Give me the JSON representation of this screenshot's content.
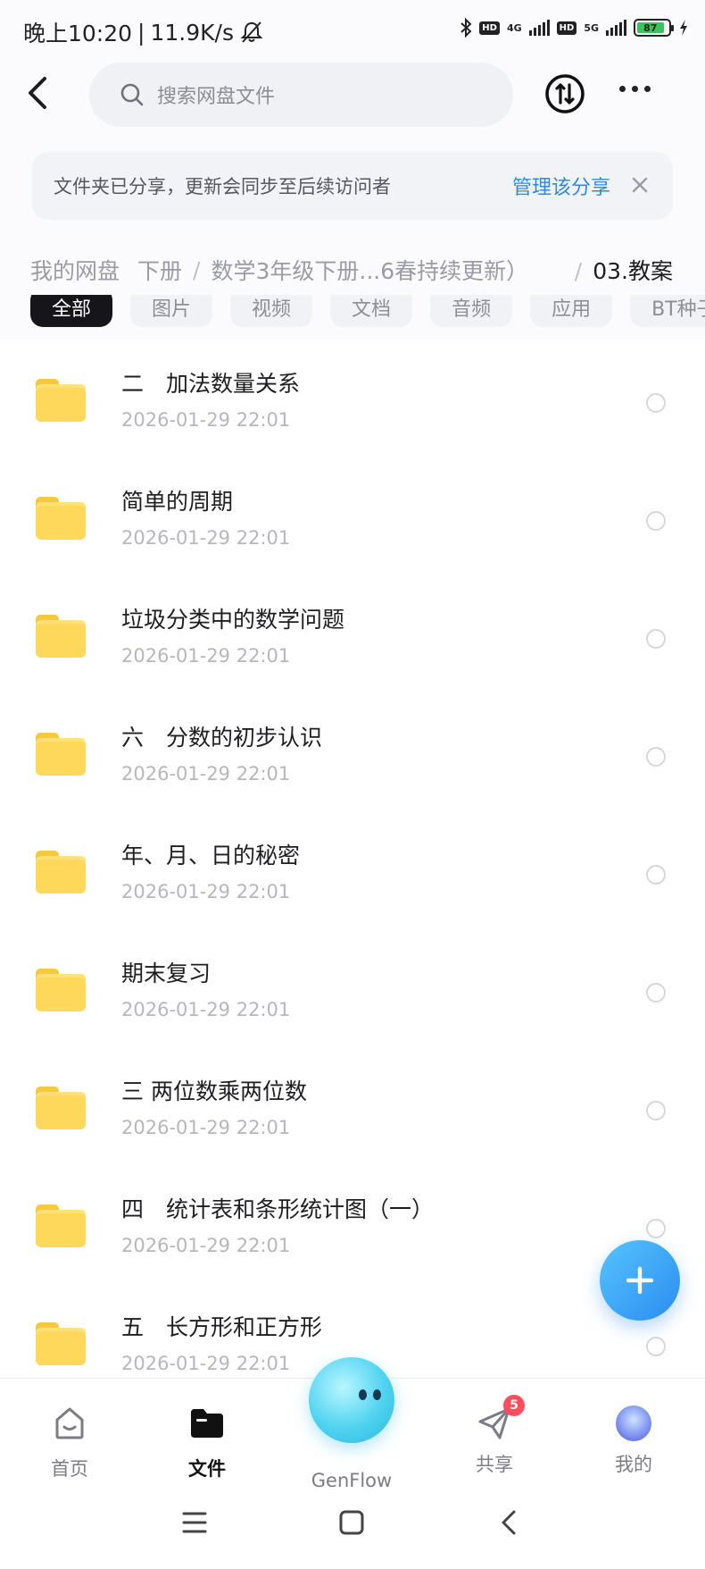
{
  "status_bar": {
    "time": "晚上10:20",
    "speed": "11.9K/s",
    "hd": "HD",
    "net1": "4G",
    "net2": "5G",
    "battery": "87"
  },
  "topbar": {
    "search_placeholder": "搜索网盘文件"
  },
  "banner": {
    "text": "文件夹已分享，更新会同步至后续访问者",
    "manage_label": "管理该分享"
  },
  "breadcrumb": {
    "root": "我的网盘",
    "level1": "下册",
    "level2": "数学3年级下册...6春持续更新）",
    "current": "03.教案"
  },
  "filters": [
    "全部",
    "图片",
    "视频",
    "文档",
    "音频",
    "应用",
    "BT种子"
  ],
  "files": [
    {
      "name": "二　加法数量关系",
      "date": "2026-01-29  22:01"
    },
    {
      "name": "简单的周期",
      "date": "2026-01-29  22:01"
    },
    {
      "name": "垃圾分类中的数学问题",
      "date": "2026-01-29  22:01"
    },
    {
      "name": "六　分数的初步认识",
      "date": "2026-01-29  22:01"
    },
    {
      "name": "年、月、日的秘密",
      "date": "2026-01-29  22:01"
    },
    {
      "name": "期末复习",
      "date": "2026-01-29  22:01"
    },
    {
      "name": "三  两位数乘两位数",
      "date": "2026-01-29  22:01"
    },
    {
      "name": "四　统计表和条形统计图（一）",
      "date": "2026-01-29  22:01"
    },
    {
      "name": "五　长方形和正方形",
      "date": "2026-01-29  22:01"
    }
  ],
  "bottom_nav": {
    "home": "首页",
    "files": "文件",
    "genflow": "GenFlow",
    "share": "共享",
    "share_badge": "5",
    "me": "我的"
  },
  "colors": {
    "accent": "#2a8be6",
    "folder": "#fdd85a",
    "fab": "#2a8df0"
  }
}
